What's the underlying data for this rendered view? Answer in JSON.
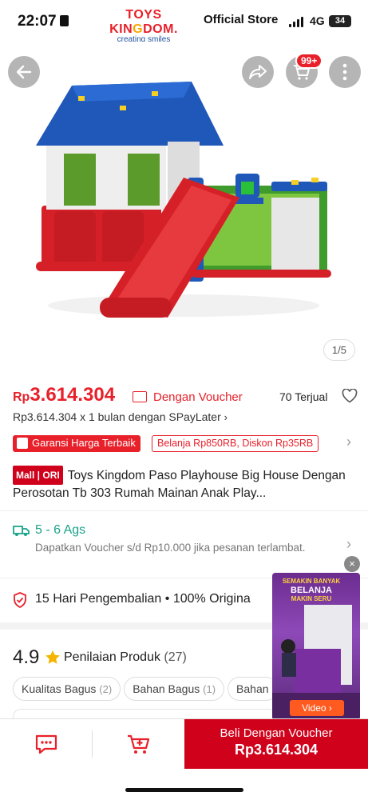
{
  "status_bar": {
    "time": "22:07",
    "network": "4G",
    "battery": "34"
  },
  "brand": {
    "name_parts": [
      "TOYS ",
      "KIN",
      "G",
      "DOM."
    ],
    "tagline": "creating smiles",
    "store_label": "Official Store"
  },
  "gallery": {
    "cart_badge": "99+",
    "page_indicator": "1/5"
  },
  "price": {
    "currency": "Rp",
    "amount": "3.614.304",
    "voucher_label": "Dengan Voucher",
    "sold": "70 Terjual",
    "paylater": "Rp3.614.304 x 1 bulan dengan SPayLater"
  },
  "guarantee": {
    "badge": "Garansi Harga Terbaik",
    "discount": "Belanja Rp850RB, Diskon Rp35RB"
  },
  "product": {
    "mall_badge": "Mall | ORI",
    "title": "Toys Kingdom Paso Playhouse Big House Dengan Perosotan Tb 303 Rumah Mainan Anak Play..."
  },
  "shipping": {
    "time": "5 - 6 Ags",
    "note": "Dapatkan Voucher s/d Rp10.000 jika pesanan terlambat."
  },
  "returns": {
    "text": "15 Hari Pengembalian  •  100% Origina"
  },
  "rating": {
    "value": "4.9",
    "label": "Penilaian Produk",
    "count": "(27)",
    "tags": [
      {
        "label": "Kualitas Bagus",
        "count": "(2)"
      },
      {
        "label": "Bahan Bagus",
        "count": "(1)"
      },
      {
        "label": "Bahan",
        "count": ""
      }
    ]
  },
  "video": {
    "banner_line1": "SEMAKIN BANYAK",
    "banner_line2": "BELANJA",
    "banner_line3": "MAKIN SERU",
    "button": "Video ›"
  },
  "bottom_bar": {
    "buy_label": "Beli Dengan Voucher",
    "buy_price": "Rp3.614.304"
  },
  "colors": {
    "accent": "#e8202a",
    "buy_button": "#d0011b",
    "shipping": "#1aa38a"
  }
}
